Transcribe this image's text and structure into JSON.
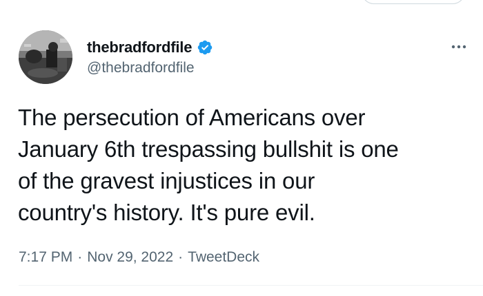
{
  "tweet": {
    "author": {
      "display_name": "thebradfordfile",
      "handle": "@thebradfordfile",
      "verified": true,
      "verified_icon": "verified-badge-icon",
      "avatar": "profile-photo"
    },
    "text_lines": [
      "The persecution of Americans over",
      "January 6th trespassing bullshit is one",
      "of the gravest injustices in our",
      "country's history. It's pure evil."
    ],
    "meta": {
      "time": "7:17 PM",
      "separator": "·",
      "date": "Nov 29, 2022",
      "source": "TweetDeck"
    },
    "more_icon": "more-options-icon"
  },
  "colors": {
    "text_primary": "#0f1419",
    "text_secondary": "#536471",
    "verified_blue": "#1d9bf0",
    "divider": "#eff3f4"
  }
}
